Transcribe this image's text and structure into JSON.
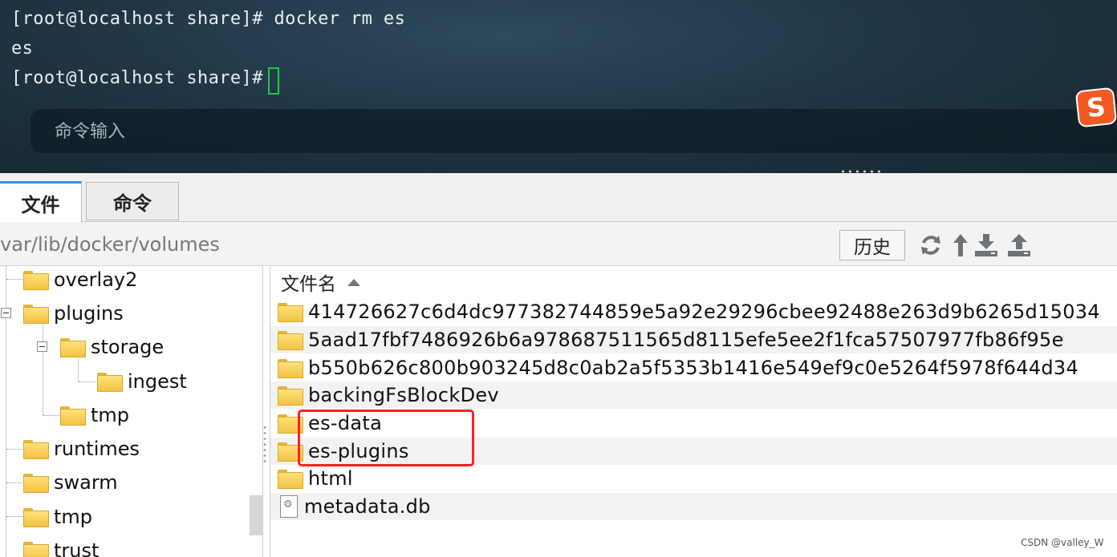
{
  "terminal": {
    "lines": [
      "[root@localhost share]# docker rm es",
      "es",
      "[root@localhost share]# "
    ],
    "input_placeholder": "命令输入",
    "ime_badge": "S"
  },
  "tabs": [
    {
      "label": "文件",
      "active": true
    },
    {
      "label": "命令",
      "active": false
    }
  ],
  "pathbar": {
    "path": "/var/lib/docker/volumes",
    "history_label": "历史",
    "tools": [
      "refresh-icon",
      "up-directory-icon",
      "download-icon",
      "upload-icon"
    ]
  },
  "tree": {
    "items": [
      {
        "label": "overlay2",
        "level": 0
      },
      {
        "label": "plugins",
        "level": 0,
        "expanded": true
      },
      {
        "label": "storage",
        "level": 1,
        "expanded": true
      },
      {
        "label": "ingest",
        "level": 2
      },
      {
        "label": "tmp",
        "level": 1
      },
      {
        "label": "runtimes",
        "level": 0
      },
      {
        "label": "swarm",
        "level": 0
      },
      {
        "label": "tmp",
        "level": 0
      },
      {
        "label": "trust",
        "level": 0
      }
    ]
  },
  "filelist": {
    "column_header": "文件名",
    "sort": "ascending",
    "rows": [
      {
        "name": "414726627c6d4dc977382744859e5a92e29296cbee92488e263d9b6265d15034",
        "type": "folder"
      },
      {
        "name": "5aad17fbf7486926b6a978687511565d8115efe5ee2f1fca57507977fb86f95e",
        "type": "folder"
      },
      {
        "name": "b550b626c800b903245d8c0ab2a5f5353b1416e549ef9c0e5264f5978f644d34",
        "type": "folder"
      },
      {
        "name": "backingFsBlockDev",
        "type": "folder"
      },
      {
        "name": "es-data",
        "type": "folder",
        "highlighted": true
      },
      {
        "name": "es-plugins",
        "type": "folder",
        "highlighted": true
      },
      {
        "name": "html",
        "type": "folder"
      },
      {
        "name": "metadata.db",
        "type": "file"
      }
    ]
  },
  "watermark": "CSDN @valley_W",
  "colors": {
    "highlight": "#ff2020",
    "cursor": "#1ec94a",
    "active_tab_accent": "#3c8de6",
    "ime_badge": "#f25a24"
  }
}
